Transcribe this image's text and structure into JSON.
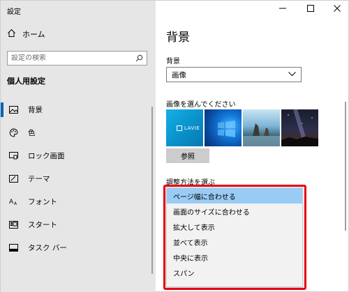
{
  "window": {
    "title": "設定",
    "controls": {
      "minimize": "—",
      "maximize": "☐",
      "close": "✕"
    }
  },
  "sidebar": {
    "home_label": "ホーム",
    "search": {
      "placeholder": "設定の検索",
      "value": ""
    },
    "section_title": "個人用設定",
    "items": [
      {
        "label": "背景",
        "icon": "picture-icon",
        "active": true
      },
      {
        "label": "色",
        "icon": "palette-icon",
        "active": false
      },
      {
        "label": "ロック画面",
        "icon": "lock-screen-icon",
        "active": false
      },
      {
        "label": "テーマ",
        "icon": "theme-icon",
        "active": false
      },
      {
        "label": "フォント",
        "icon": "font-icon",
        "active": false
      },
      {
        "label": "スタート",
        "icon": "start-icon",
        "active": false
      },
      {
        "label": "タスク バー",
        "icon": "taskbar-icon",
        "active": false
      }
    ]
  },
  "main": {
    "page_title": "背景",
    "background_label": "背景",
    "background_select": {
      "value": "画像"
    },
    "choose_picture_label": "画像を選んでください",
    "thumbnail_text": "LAVIE",
    "browse_label": "参照",
    "fit_label": "調整方法を選ぶ",
    "fit_options": [
      {
        "label": "ページ幅に合わせる",
        "selected": true
      },
      {
        "label": "画面のサイズに合わせる",
        "selected": false
      },
      {
        "label": "拡大して表示",
        "selected": false
      },
      {
        "label": "並べて表示",
        "selected": false
      },
      {
        "label": "中央に表示",
        "selected": false
      },
      {
        "label": "スパン",
        "selected": false
      }
    ]
  },
  "colors": {
    "sidebar_bg": "#e6e6e6",
    "accent": "#0063b1",
    "selected_option": "#99ccf5",
    "highlight_border": "#e60012"
  }
}
